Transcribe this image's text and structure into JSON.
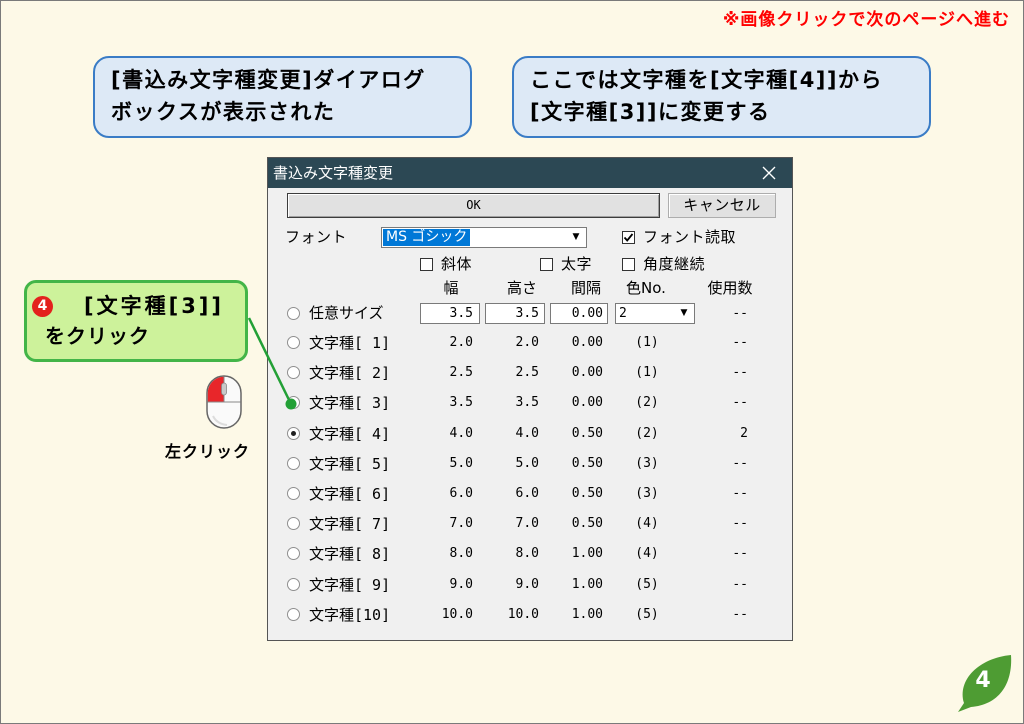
{
  "colors": {
    "page_bg": "#fdf9e7",
    "nav_hint": "#ff0000",
    "info_bg": "#dde9f6",
    "info_border": "#3a7cc6",
    "step_bg": "#cdf29b",
    "step_border": "#43b548",
    "step_badge": "#e3211d",
    "connector": "#23a036",
    "titlebar": "#2c4854",
    "selection": "#0078d7",
    "leaf": "#4e9c33",
    "mouse_button": "#e8262a"
  },
  "page": {
    "nav_hint": "※画像クリックで次のページへ進む",
    "page_number": "4",
    "page_number_icon": "leaf-icon"
  },
  "info_callouts": [
    {
      "lines": [
        "[書込み文字種変更]ダイアログ",
        "ボックスが表示された"
      ]
    },
    {
      "lines": [
        "ここでは文字種を[文字種[4]]から",
        "[文字種[3]]に変更する"
      ]
    }
  ],
  "step_callout": {
    "number": "4",
    "lines": [
      "[文字種[3]]",
      "をクリック"
    ]
  },
  "mouse": {
    "icon": "mouse-left-click-icon",
    "label": "左クリック"
  },
  "dialog": {
    "title": "書込み文字種変更",
    "close_icon": "close-icon",
    "ok_label": "OK",
    "cancel_label": "キャンセル",
    "font": {
      "label": "フォント",
      "value": "MS ゴシック",
      "dropdown_icon": "chevron-down-icon"
    },
    "checkboxes": [
      {
        "label": "フォント読取",
        "checked": true
      },
      {
        "label": "斜体",
        "checked": false
      },
      {
        "label": "太字",
        "checked": false
      },
      {
        "label": "角度継続",
        "checked": false
      }
    ],
    "columns": [
      "幅",
      "高さ",
      "間隔",
      "色No.",
      "使用数"
    ],
    "custom_row": {
      "label": "任意サイズ",
      "selected": false,
      "width": "3.5",
      "height": "3.5",
      "spacing": "0.00",
      "color": "2",
      "usage": "--"
    },
    "rows": [
      {
        "label": "文字種[ 1]",
        "width": "2.0",
        "height": "2.0",
        "spacing": "0.00",
        "color": "(1)",
        "usage": "--",
        "selected": false
      },
      {
        "label": "文字種[ 2]",
        "width": "2.5",
        "height": "2.5",
        "spacing": "0.00",
        "color": "(1)",
        "usage": "--",
        "selected": false
      },
      {
        "label": "文字種[ 3]",
        "width": "3.5",
        "height": "3.5",
        "spacing": "0.00",
        "color": "(2)",
        "usage": "--",
        "selected": false
      },
      {
        "label": "文字種[ 4]",
        "width": "4.0",
        "height": "4.0",
        "spacing": "0.50",
        "color": "(2)",
        "usage": "2",
        "selected": true
      },
      {
        "label": "文字種[ 5]",
        "width": "5.0",
        "height": "5.0",
        "spacing": "0.50",
        "color": "(3)",
        "usage": "--",
        "selected": false
      },
      {
        "label": "文字種[ 6]",
        "width": "6.0",
        "height": "6.0",
        "spacing": "0.50",
        "color": "(3)",
        "usage": "--",
        "selected": false
      },
      {
        "label": "文字種[ 7]",
        "width": "7.0",
        "height": "7.0",
        "spacing": "0.50",
        "color": "(4)",
        "usage": "--",
        "selected": false
      },
      {
        "label": "文字種[ 8]",
        "width": "8.0",
        "height": "8.0",
        "spacing": "1.00",
        "color": "(4)",
        "usage": "--",
        "selected": false
      },
      {
        "label": "文字種[ 9]",
        "width": "9.0",
        "height": "9.0",
        "spacing": "1.00",
        "color": "(5)",
        "usage": "--",
        "selected": false
      },
      {
        "label": "文字種[10]",
        "width": "10.0",
        "height": "10.0",
        "spacing": "1.00",
        "color": "(5)",
        "usage": "--",
        "selected": false
      }
    ]
  }
}
